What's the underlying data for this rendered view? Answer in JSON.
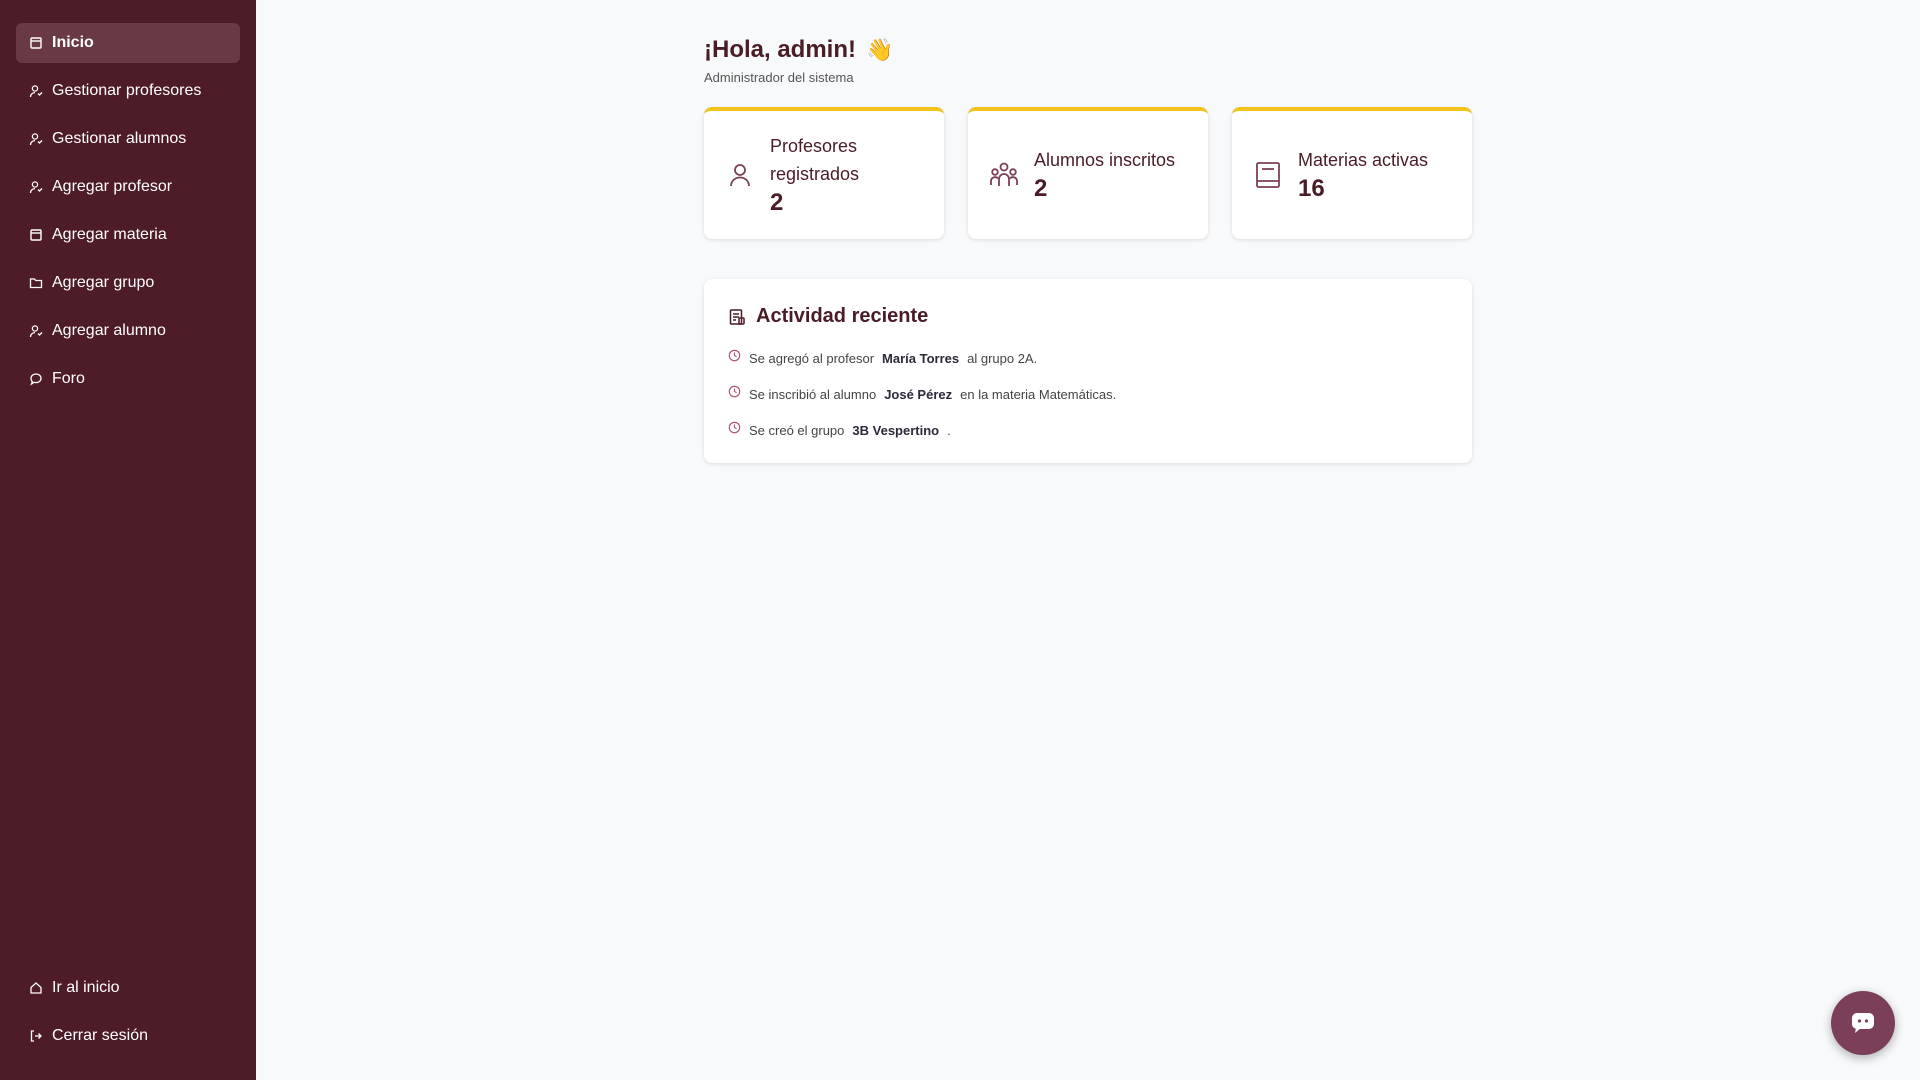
{
  "sidebar": {
    "items": [
      {
        "label": "Inicio",
        "icon": "calendar-icon",
        "active": true
      },
      {
        "label": "Gestionar profesores",
        "icon": "user-icon"
      },
      {
        "label": "Gestionar alumnos",
        "icon": "user-icon"
      },
      {
        "label": "Agregar profesor",
        "icon": "user-icon"
      },
      {
        "label": "Agregar materia",
        "icon": "calendar-icon"
      },
      {
        "label": "Agregar grupo",
        "icon": "folder-icon"
      },
      {
        "label": "Agregar alumno",
        "icon": "user-icon"
      },
      {
        "label": "Foro",
        "icon": "chat-bubble-icon"
      }
    ],
    "bottom": [
      {
        "label": "Ir al inicio",
        "icon": "home-icon"
      },
      {
        "label": "Cerrar sesión",
        "icon": "logout-icon"
      }
    ]
  },
  "header": {
    "greeting": "¡Hola, admin!",
    "emoji": "👋",
    "subtitle": "Administrador del sistema"
  },
  "stats": [
    {
      "label": "Profesores registrados",
      "value": "2",
      "icon": "user-icon"
    },
    {
      "label": "Alumnos inscritos",
      "value": "2",
      "icon": "group-icon"
    },
    {
      "label": "Materias activas",
      "value": "16",
      "icon": "book-icon"
    }
  ],
  "activity": {
    "title": "Actividad reciente",
    "items": [
      {
        "pre": "Se agregó al profesor",
        "bold": "María Torres",
        "post": "al grupo 2A."
      },
      {
        "pre": "Se inscribió al alumno",
        "bold": "José Pérez",
        "post": "en la materia Matemáticas."
      },
      {
        "pre": "Se creó el grupo",
        "bold": "3B Vespertino",
        "post": "."
      }
    ]
  },
  "colors": {
    "sidebar": "#4d1c27",
    "accent": "#f2c31b",
    "primary_text": "#4a1c25",
    "chat_button": "#7b3f5a"
  }
}
